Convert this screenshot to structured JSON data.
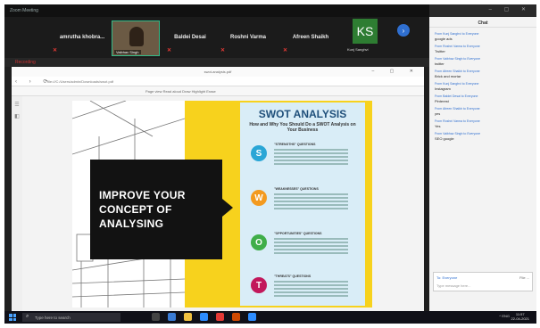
{
  "meeting": {
    "title_bar": "Zoom Meeting",
    "participants": [
      {
        "name": "amrutha khobra..."
      },
      {
        "name": "Baldei Desai"
      },
      {
        "name": "Roshni Varma"
      },
      {
        "name": "Afreen Shaikh"
      }
    ],
    "video_tile_label": "Vaibhav Singh",
    "ks_initials": "KS",
    "ks_label": "Kunj Sanghvi",
    "sharing_label": "Recording"
  },
  "browser": {
    "tab_title": "swot-analysis.pdf",
    "address": "file:///C:/Users/admin/Downloads/swot.pdf",
    "pdf_toolbar": "Page view   Read aloud   Draw   Highlight   Erase"
  },
  "slide": {
    "headline": "IMPROVE YOUR CONCEPT OF ANALYSING",
    "poster_title": "SWOT ANALYSIS",
    "poster_subtitle": "How and Why You Should Do a SWOT Analysis on Your Business",
    "letters": [
      "S",
      "W",
      "O",
      "T"
    ],
    "sections": [
      "\"STRENGTHS\" QUESTIONS",
      "\"WEAKNESSES\" QUESTIONS",
      "\"OPPORTUNITIES\" QUESTIONS",
      "\"THREATS\" QUESTIONS"
    ],
    "colors": {
      "S": "#2aa6d6",
      "W": "#f39a1f",
      "O": "#3fae49",
      "T": "#c2185b"
    }
  },
  "chat": {
    "title": "Chat",
    "messages": [
      {
        "from": "From Kunj Sanghvi to Everyone",
        "text": "google ads"
      },
      {
        "from": "From Roshni Varma to Everyone",
        "text": "Twitter"
      },
      {
        "from": "From Vaibhav Singh to Everyone",
        "text": "twitter"
      },
      {
        "from": "From Afreen Shaikh to Everyone",
        "text": "Brick and mortar"
      },
      {
        "from": "From Kunj Sanghvi to Everyone",
        "text": "Instagram"
      },
      {
        "from": "From Baldei Desai to Everyone",
        "text": "Pinterest"
      },
      {
        "from": "From Afreen Shaikh to Everyone",
        "text": "yes"
      },
      {
        "from": "From Roshni Varma to Everyone",
        "text": "Yes"
      },
      {
        "from": "From Vaibhav Singh to Everyone",
        "text": "SEO google"
      }
    ],
    "to_label": "To: Everyone",
    "placeholder": "Type message here...",
    "tools": "File  ..."
  },
  "taskbar": {
    "search_placeholder": "Type here to search",
    "tray": "^  ENG",
    "time": "11:57",
    "date": "22-04-2021"
  }
}
